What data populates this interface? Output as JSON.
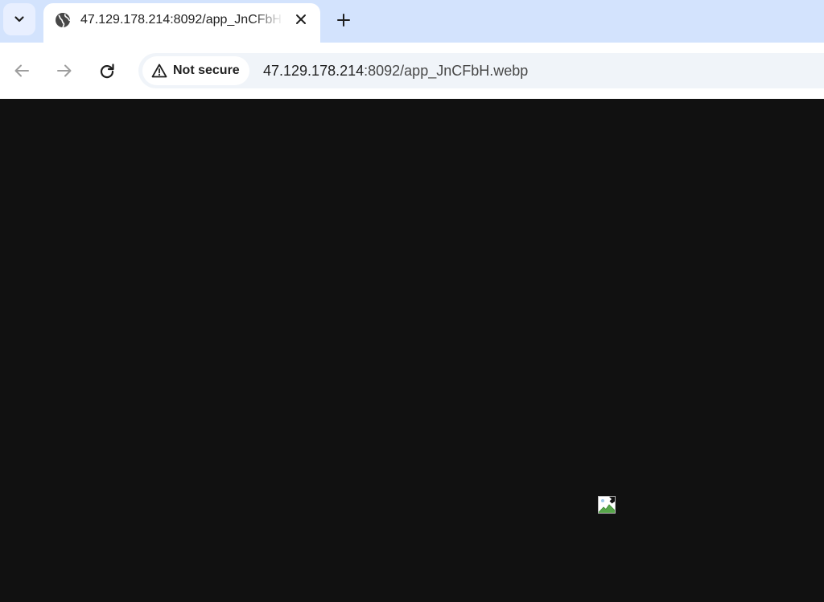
{
  "tabstrip": {
    "tab_search_icon": "chevron-down-icon",
    "active_tab": {
      "favicon": "globe-icon",
      "title": "47.129.178.214:8092/app_JnCFbH.webp",
      "close_icon": "close-icon"
    },
    "new_tab_icon": "plus-icon"
  },
  "toolbar": {
    "back_icon": "arrow-left-icon",
    "forward_icon": "arrow-right-icon",
    "reload_icon": "reload-icon",
    "security": {
      "icon": "warning-triangle-icon",
      "label": "Not secure"
    },
    "url": {
      "host": "47.129.178.214",
      "rest": ":8092/app_JnCFbH.webp"
    }
  },
  "content": {
    "background_color": "#111111",
    "image_state": "broken-image-icon"
  },
  "colors": {
    "tabstrip_bg": "#d3e3fd",
    "omnibox_bg": "#f0f4f9",
    "page_bg": "#111111"
  }
}
